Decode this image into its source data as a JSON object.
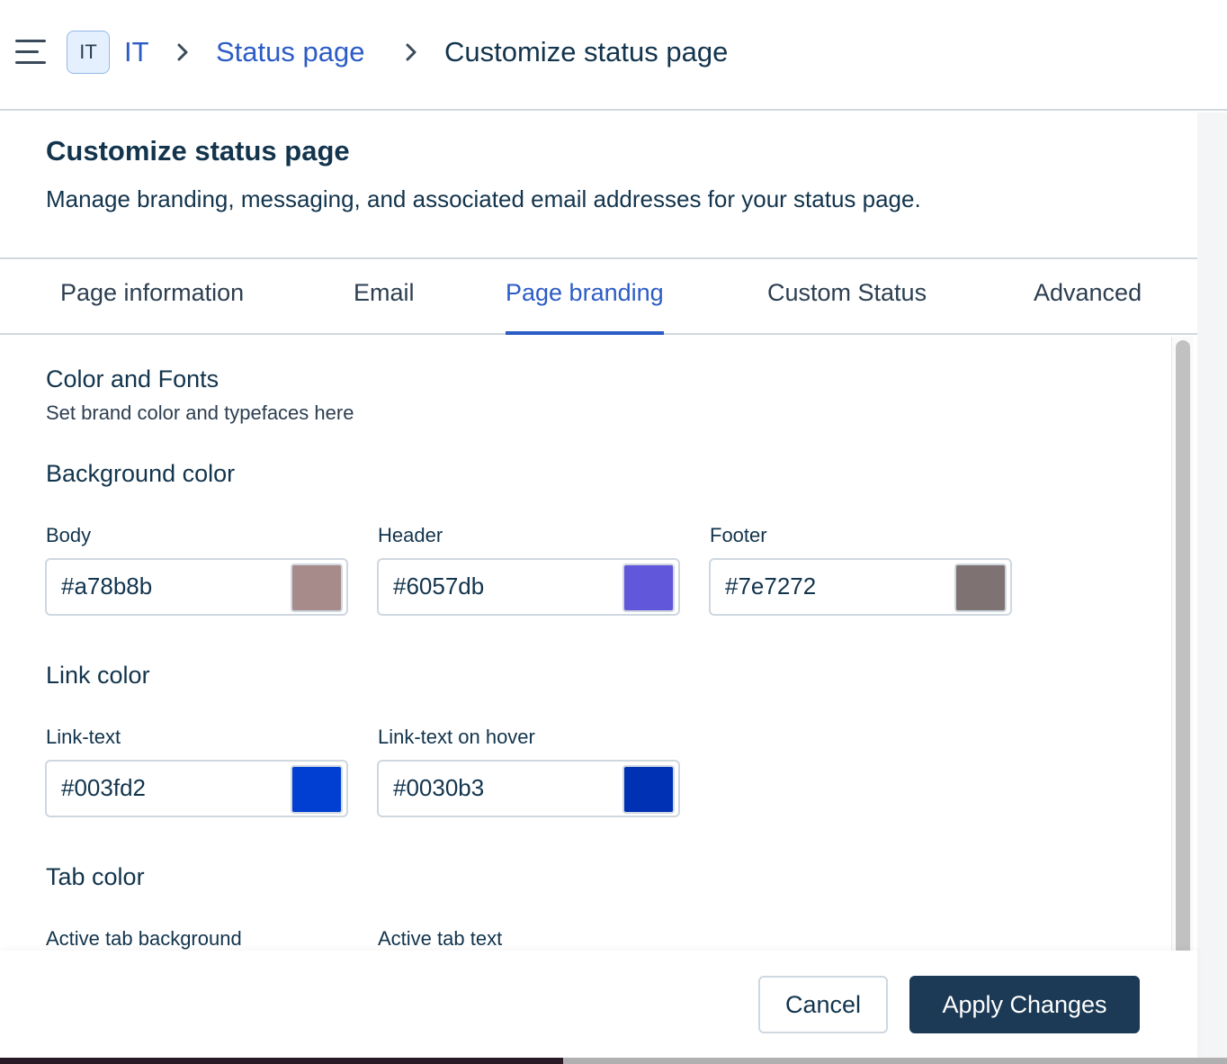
{
  "breadcrumb": {
    "workspace_badge": "IT",
    "workspace": "IT",
    "section": "Status page",
    "current": "Customize status page"
  },
  "page": {
    "title": "Customize status page",
    "description": "Manage branding, messaging, and associated email addresses for your status page."
  },
  "tabs": [
    {
      "label": "Page information",
      "active": false
    },
    {
      "label": "Email",
      "active": false
    },
    {
      "label": "Page branding",
      "active": true
    },
    {
      "label": "Custom Status",
      "active": false
    },
    {
      "label": "Advanced",
      "active": false
    }
  ],
  "branding": {
    "section_title": "Color and Fonts",
    "section_subtitle": "Set brand color and typefaces here",
    "background": {
      "title": "Background color",
      "body": {
        "label": "Body",
        "value": "#a78b8b",
        "swatch": "#a78b8b"
      },
      "header": {
        "label": "Header",
        "value": "#6057db",
        "swatch": "#6057db"
      },
      "footer": {
        "label": "Footer",
        "value": "#7e7272",
        "swatch": "#7e7272"
      }
    },
    "link": {
      "title": "Link color",
      "text": {
        "label": "Link-text",
        "value": "#003fd2",
        "swatch": "#003fd2"
      },
      "hover": {
        "label": "Link-text on hover",
        "value": "#0030b3",
        "swatch": "#0030b3"
      }
    },
    "tab": {
      "title": "Tab color",
      "active_bg": {
        "label": "Active tab background"
      },
      "active_text": {
        "label": "Active tab text"
      }
    }
  },
  "actions": {
    "cancel": "Cancel",
    "apply": "Apply Changes"
  },
  "colors": {
    "accent": "#2c5cc5",
    "primary_button": "#1c3a55",
    "text": "#12344d",
    "border": "#cfd7df"
  },
  "icons": {
    "menu": "hamburger-menu-icon",
    "separator": "chevron-right-icon"
  }
}
